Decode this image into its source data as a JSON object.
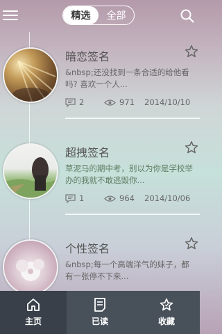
{
  "header": {
    "tabs": [
      {
        "label": "精选",
        "active": true
      },
      {
        "label": "全部",
        "active": false
      }
    ]
  },
  "items": [
    {
      "title": "暗恋签名",
      "desc": "&nbsp;还没找到一条合适的给他看吗? 喜欢一个人...",
      "comments": "2",
      "views": "971",
      "date": "2014/10/10"
    },
    {
      "title": "超拽签名",
      "desc": "草泥马的期中考，别以为你是学校举办的我就不敢逃毁你...",
      "comments": "1",
      "views": "964",
      "date": "2014/10/06"
    },
    {
      "title": "个性签名",
      "desc": "&nbsp;每一个高端洋气的妹子，都有一张停不下来...",
      "comments": "",
      "views": "",
      "date": ""
    }
  ],
  "bottom_nav": [
    {
      "label": "主页",
      "icon": "home-icon"
    },
    {
      "label": "已读",
      "icon": "document-icon"
    },
    {
      "label": "收藏",
      "icon": "star-icon"
    }
  ],
  "colors": {
    "bottom_bar": "#48505a",
    "bottom_bar_selected": "#39404a",
    "desc_green": "#5f7d63"
  }
}
